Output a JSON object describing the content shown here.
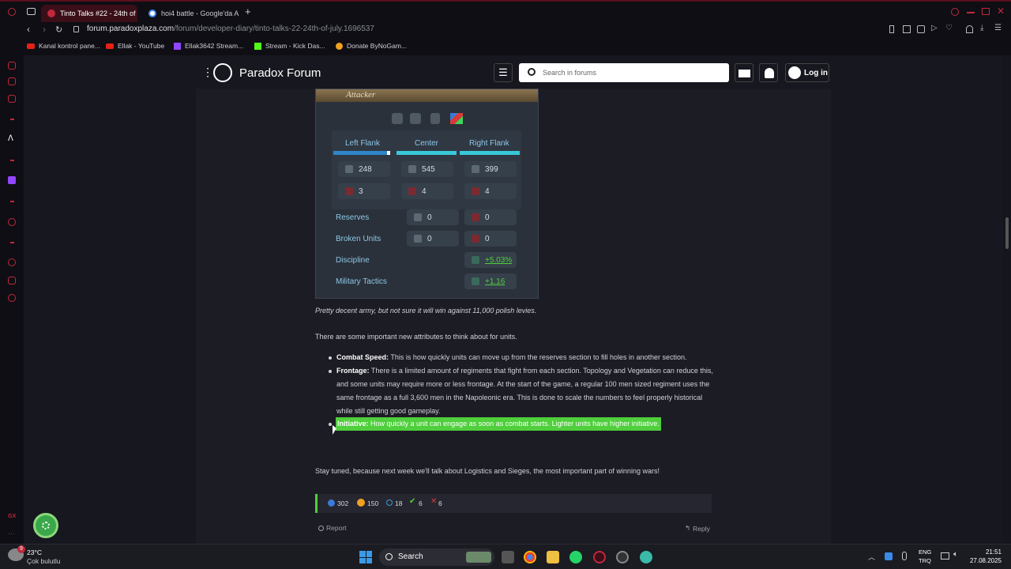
{
  "browser": {
    "tabs": [
      {
        "label": "Tinto Talks #22 - 24th of",
        "active": true
      },
      {
        "label": "hoi4 battle - Google'da A",
        "active": false
      }
    ],
    "new_tab": "+",
    "url_host": "forum.paradoxplaza.com",
    "url_path": "/forum/developer-diary/tinto-talks-22-24th-of-july.1696537",
    "bookmarks": [
      "Kanal kontrol pane...",
      "Ellak - YouTube",
      "Ellak3642 Stream...",
      "Stream - Kick Das...",
      "Donate ByNoGam..."
    ]
  },
  "header": {
    "site_title": "Paradox Forum",
    "search_placeholder": "Search in forums",
    "login_label": "Log in"
  },
  "battle": {
    "role": "Attacker",
    "columns": [
      "Left Flank",
      "Center",
      "Right Flank"
    ],
    "men_row": [
      "248",
      "545",
      "399"
    ],
    "units_row": [
      "3",
      "4",
      "4"
    ],
    "reserves_label": "Reserves",
    "reserves": [
      "0",
      "0"
    ],
    "broken_label": "Broken Units",
    "broken": [
      "0",
      "0"
    ],
    "discipline_label": "Discipline",
    "discipline": "+5.03%",
    "tactics_label": "Military Tactics",
    "tactics": "+1.16"
  },
  "post": {
    "caption": "Pretty decent army, but not sure it will win against 11,000 polish levies.",
    "intro": "There are some important new attributes to think about for units.",
    "items": [
      {
        "term": "Combat Speed:",
        "text": " This is how quickly units can move up from the reserves section to fill holes in another section."
      },
      {
        "term": "Frontage:",
        "text": " There is a limited amount of regiments that fight from each section. Topology and Vegetation can reduce this, and some units may require more or less frontage. At the start of the game, a regular 100 men sized regiment uses the same frontage as a full 3,600 men in the Napoleonic era. This is done to scale the numbers to feel properly historical while still getting good gameplay."
      },
      {
        "term": "Initiative:",
        "text": " How quickly a unit can engage as soon as combat starts. Lighter units have higher initiative."
      }
    ],
    "outro": "Stay tuned, because next week we'll talk about Logistics and Sieges, the most important part of winning wars!"
  },
  "reactions": {
    "like": "302",
    "love": "150",
    "info": "18",
    "agree": "6",
    "disagree": "6"
  },
  "footer_actions": {
    "report": "Report",
    "reply": "Reply"
  },
  "taskbar": {
    "weather_temp": "23°C",
    "weather_desc": "Çok bulutlu",
    "weather_badge": "9",
    "search": "Search",
    "lang1": "ENG",
    "lang2": "TRQ",
    "time": "21:51",
    "date": "27.08.2025"
  },
  "colors": {
    "accent_red": "#c0283c",
    "highlight_green": "#4fcf3c",
    "forum_blue": "#8fc7e6"
  }
}
